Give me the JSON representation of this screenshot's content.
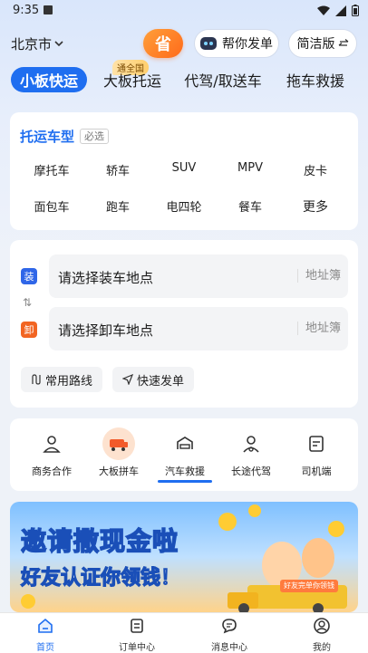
{
  "status": {
    "time": "9:35"
  },
  "header": {
    "city": "北京市",
    "sheng_label": "省",
    "help_label": "帮你发单",
    "simple_label": "简洁版"
  },
  "tabs": [
    {
      "label": "小板快运",
      "active": true
    },
    {
      "label": "大板托运",
      "badge": "通全国"
    },
    {
      "label": "代驾/取送车"
    },
    {
      "label": "拖车救援"
    }
  ],
  "vehicle_type": {
    "title": "托运车型",
    "required": "必选",
    "options": [
      "摩托车",
      "轿车",
      "SUV",
      "MPV",
      "皮卡",
      "面包车",
      "跑车",
      "电四轮",
      "餐车",
      "更多"
    ]
  },
  "address": {
    "load_badge": "装",
    "unload_badge": "卸",
    "load_placeholder": "请选择装车地点",
    "unload_placeholder": "请选择卸车地点",
    "book_label": "地址簿",
    "routes_label": "常用路线",
    "quick_label": "快速发单"
  },
  "services": [
    {
      "label": "商务合作",
      "icon": "business-icon"
    },
    {
      "label": "大板拼车",
      "icon": "carpool-icon"
    },
    {
      "label": "汽车救援",
      "icon": "rescue-icon",
      "active": true
    },
    {
      "label": "长途代驾",
      "icon": "driver-icon"
    },
    {
      "label": "司机端",
      "icon": "driver-app-icon"
    }
  ],
  "banner": {
    "line1": "邀请撒现金啦",
    "line2_a": "好友认证",
    "line2_b": "你领钱",
    "line2_c": "！",
    "tag": "好友完单你领钱"
  },
  "bottom_nav": [
    {
      "label": "首页",
      "active": true
    },
    {
      "label": "订单中心"
    },
    {
      "label": "消息中心"
    },
    {
      "label": "我的"
    }
  ],
  "colors": {
    "accent": "#1f6ef0",
    "load_badge": "#2f66e8",
    "unload_badge": "#f26522",
    "sheng": "#ff7a22"
  }
}
